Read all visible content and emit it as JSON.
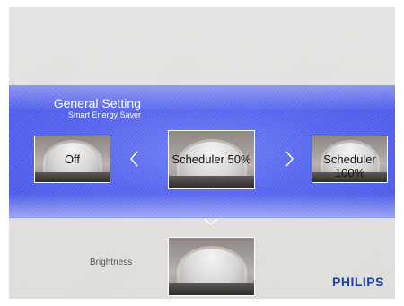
{
  "menu": {
    "title": "General Setting",
    "subtitle": "Smart Energy Saver",
    "options": [
      {
        "label": "Off"
      },
      {
        "label": "Scheduler 50%",
        "selected": true
      },
      {
        "label": "Scheduler 100%"
      }
    ]
  },
  "next_item": {
    "label": "Brightness"
  },
  "brand": {
    "logo_text": "PHILIPS",
    "color": "#1e3fa6"
  },
  "icons": {
    "left": "chevron-left-icon",
    "right": "chevron-right-icon",
    "down": "chevron-down-icon"
  },
  "colors": {
    "band": "#5564ee",
    "background": "#dedcd9"
  }
}
